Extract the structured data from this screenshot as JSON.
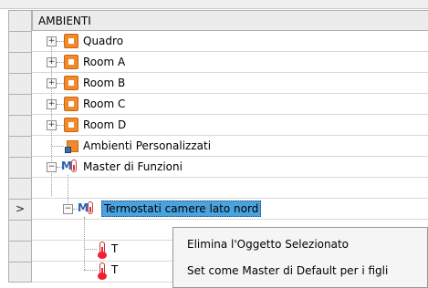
{
  "column_header": "AMBIENTI",
  "current_row_indicator": ">",
  "tree": [
    {
      "label": "Quadro",
      "icon": "room-icon",
      "expander": "+"
    },
    {
      "label": "Room A",
      "icon": "room-icon",
      "expander": "+"
    },
    {
      "label": "Room B",
      "icon": "room-icon",
      "expander": "+"
    },
    {
      "label": "Room C",
      "icon": "room-icon",
      "expander": "+"
    },
    {
      "label": "Room D",
      "icon": "room-icon",
      "expander": "+"
    },
    {
      "label": "Ambienti Personalizzati",
      "icon": "custom-ambients-icon",
      "expander": ""
    },
    {
      "label": "Master di Funzioni",
      "icon": "master-function-icon",
      "expander": "−"
    },
    {
      "label": "Termostati camere lato nord",
      "icon": "master-function-icon",
      "expander": "−",
      "selected": true
    },
    {
      "label": "T",
      "icon": "thermometer-icon",
      "expander": ""
    },
    {
      "label": "T",
      "icon": "thermometer-icon",
      "expander": ""
    }
  ],
  "context_menu": {
    "items": [
      "Elimina l'Oggetto Selezionato",
      "Set come Master di Default per i figli"
    ]
  },
  "colors": {
    "selection": "#4aa3df",
    "room_icon": "#f28a2c",
    "master_icon": "#2b5fb0",
    "thermometer": "#e22233"
  }
}
